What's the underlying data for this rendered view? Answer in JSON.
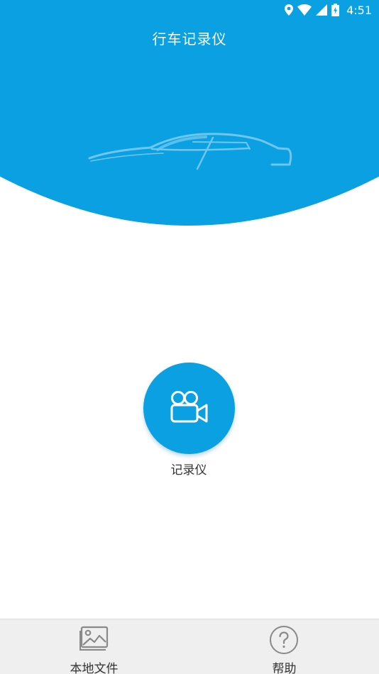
{
  "status_bar": {
    "time": "4:51",
    "icons": [
      "location-icon",
      "wifi-icon",
      "cell-signal-icon",
      "battery-charging-icon"
    ]
  },
  "header": {
    "title": "行车记录仪"
  },
  "hero": {
    "image": "car-silhouette-icon"
  },
  "main": {
    "record_button": {
      "icon": "video-camera-icon",
      "label": "记录仪"
    }
  },
  "bottom_nav": {
    "items": [
      {
        "icon": "image-gallery-icon",
        "label": "本地文件"
      },
      {
        "icon": "help-circle-icon",
        "label": "帮助"
      }
    ]
  },
  "colors": {
    "primary": "#0aa0e2",
    "hero_blue": "#0aa0e2",
    "hero_light": "#6fc7f0",
    "text_dark": "#333333",
    "nav_background": "#efefef",
    "nav_icon": "#8a8a8a"
  }
}
